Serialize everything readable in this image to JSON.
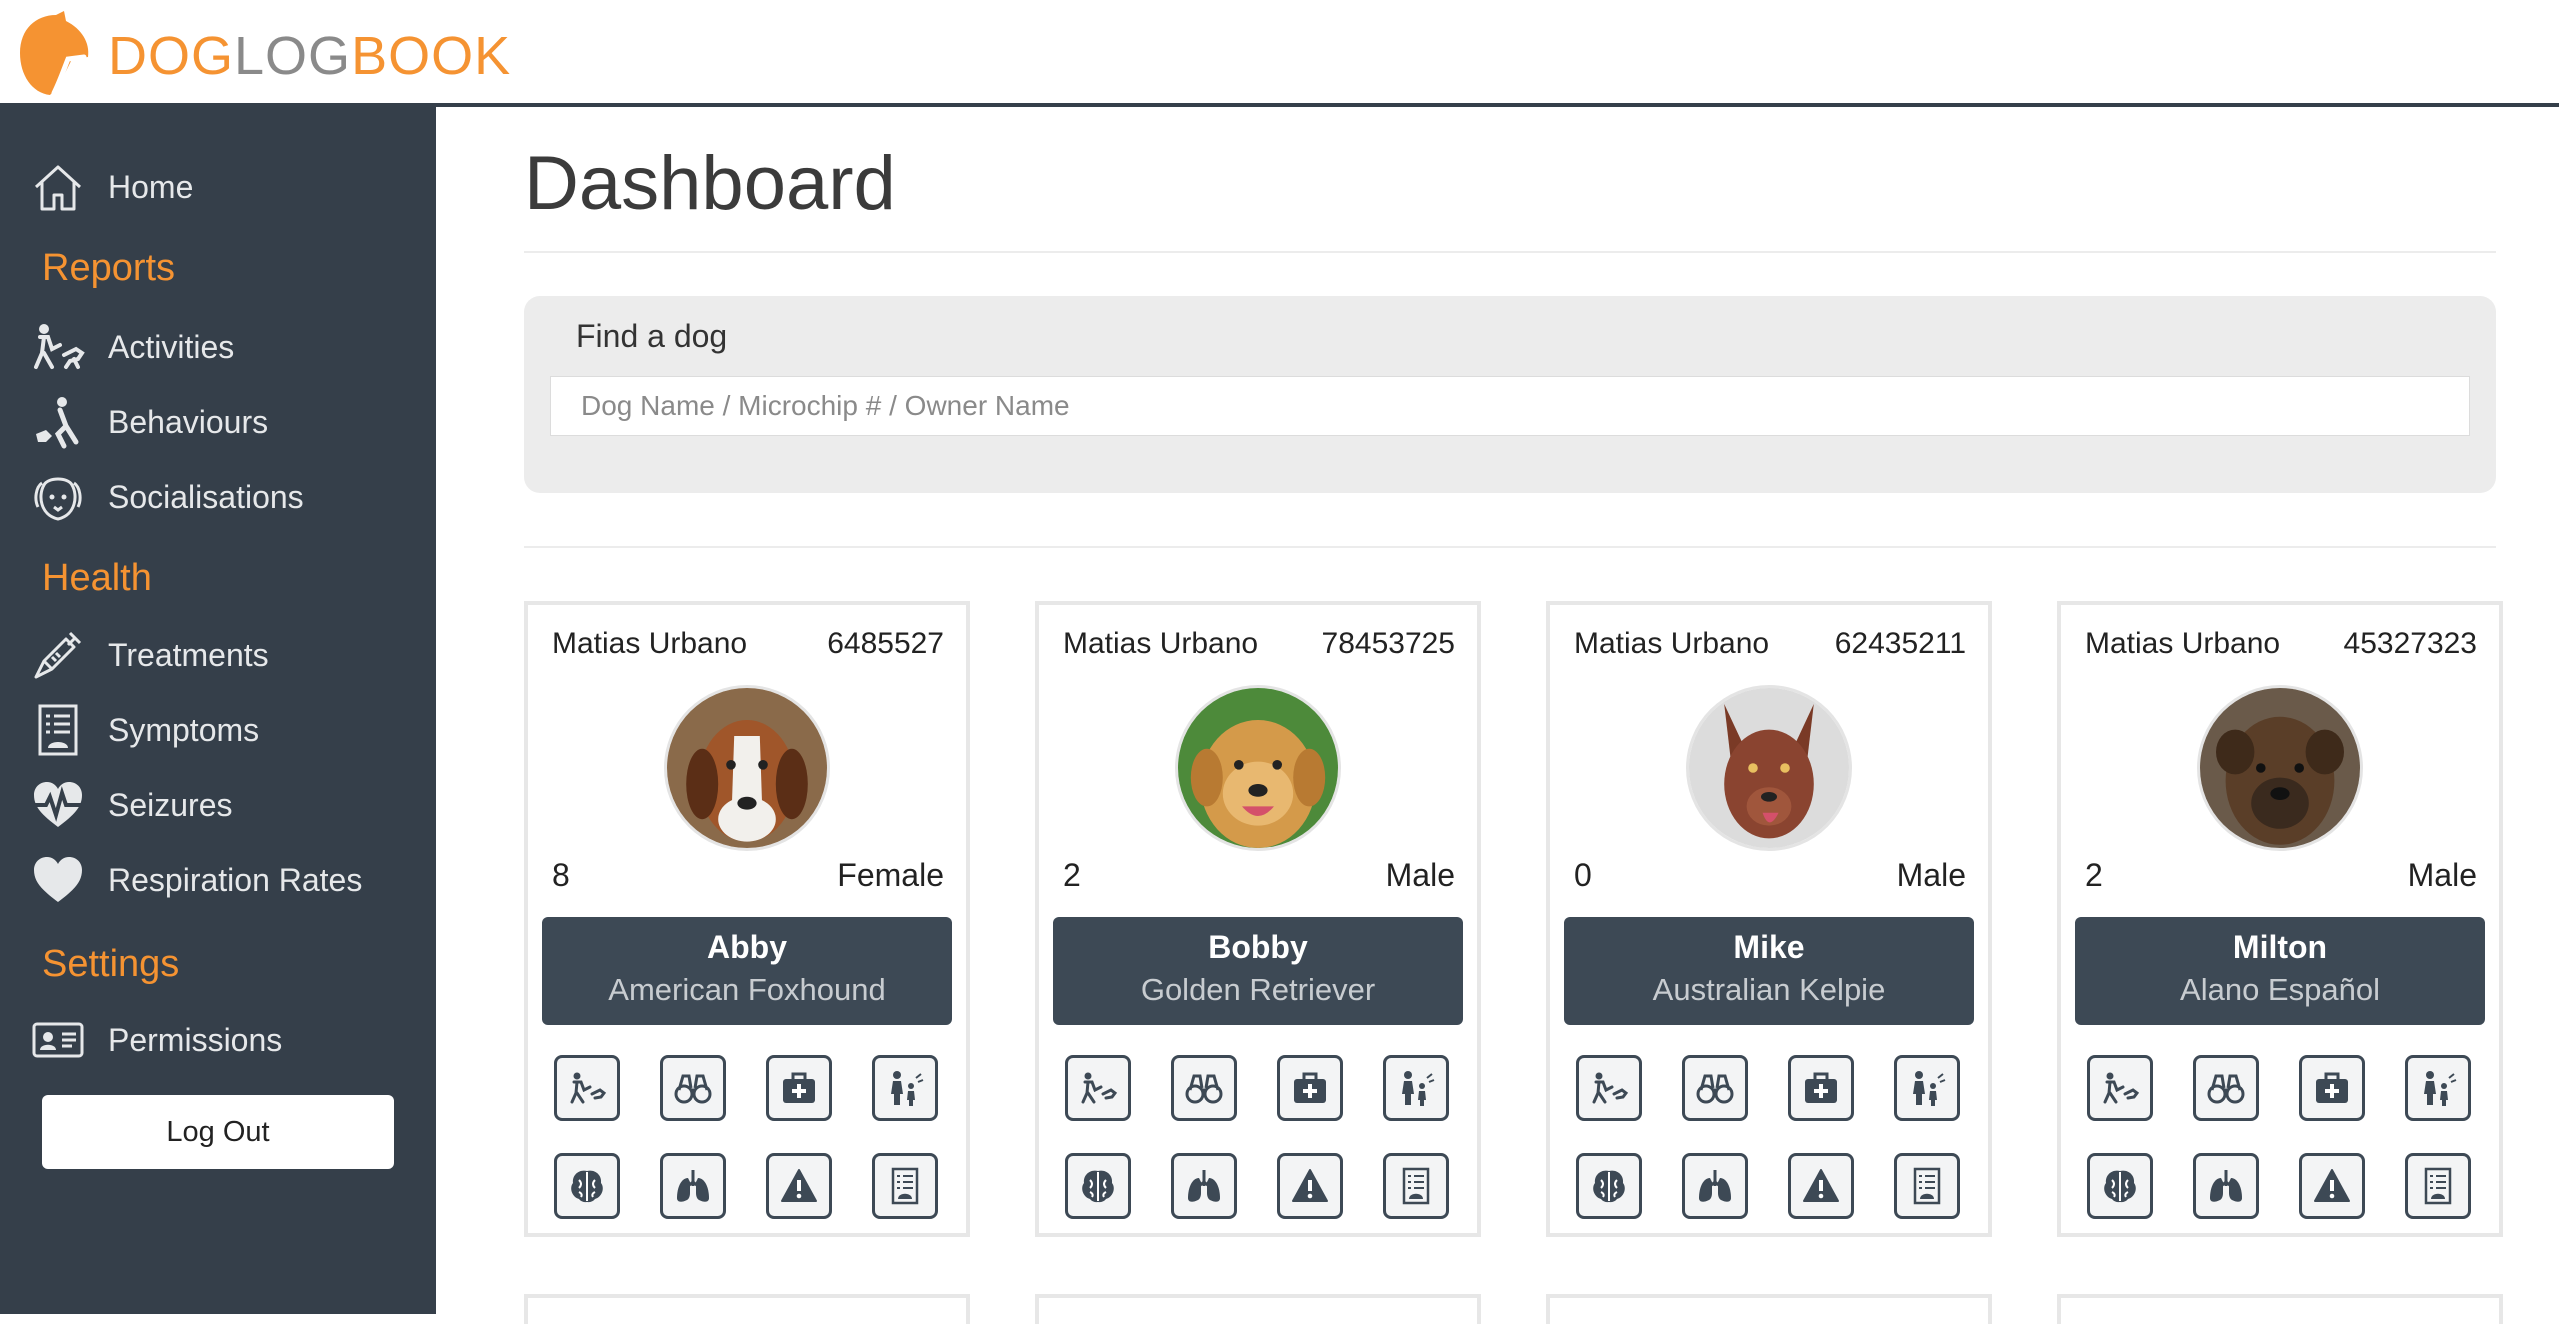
{
  "brand": {
    "part1": "DOG",
    "part2": "LOG",
    "part3": "BOOK",
    "accent": "#f59332",
    "sidebar_bg": "#353f4a"
  },
  "sidebar": {
    "home": "Home",
    "reports_heading": "Reports",
    "activities": "Activities",
    "behaviours": "Behaviours",
    "socialisations": "Socialisations",
    "health_heading": "Health",
    "treatments": "Treatments",
    "symptoms": "Symptoms",
    "seizures": "Seizures",
    "respiration": "Respiration Rates",
    "settings_heading": "Settings",
    "permissions": "Permissions",
    "logout": "Log Out"
  },
  "main": {
    "title": "Dashboard",
    "find_label": "Find a dog",
    "search_placeholder": "Dog Name / Microchip # / Owner Name"
  },
  "dogs": [
    {
      "owner": "Matias Urbano",
      "chip": "6485527",
      "age": "8",
      "sex": "Female",
      "name": "Abby",
      "breed": "American Foxhound"
    },
    {
      "owner": "Matias Urbano",
      "chip": "78453725",
      "age": "2",
      "sex": "Male",
      "name": "Bobby",
      "breed": "Golden Retriever"
    },
    {
      "owner": "Matias Urbano",
      "chip": "62435211",
      "age": "0",
      "sex": "Male",
      "name": "Mike",
      "breed": "Australian Kelpie"
    },
    {
      "owner": "Matias Urbano",
      "chip": "45327323",
      "age": "2",
      "sex": "Male",
      "name": "Milton",
      "breed": "Alano Español"
    }
  ]
}
